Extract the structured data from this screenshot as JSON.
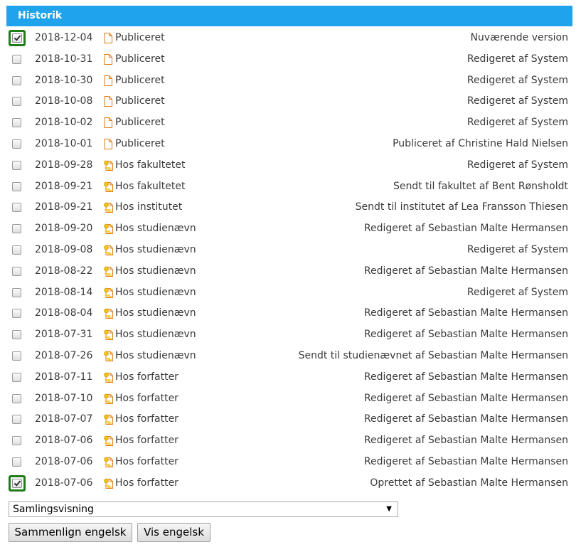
{
  "panel": {
    "title": "Historik"
  },
  "rows": [
    {
      "checked": true,
      "date": "2018-12-04",
      "status": "Publiceret",
      "status_icon": "document-icon",
      "note": "Nuværende version"
    },
    {
      "checked": false,
      "date": "2018-10-31",
      "status": "Publiceret",
      "status_icon": "document-icon",
      "note": "Redigeret af System"
    },
    {
      "checked": false,
      "date": "2018-10-30",
      "status": "Publiceret",
      "status_icon": "document-icon",
      "note": "Redigeret af System"
    },
    {
      "checked": false,
      "date": "2018-10-08",
      "status": "Publiceret",
      "status_icon": "document-icon",
      "note": "Redigeret af System"
    },
    {
      "checked": false,
      "date": "2018-10-02",
      "status": "Publiceret",
      "status_icon": "document-icon",
      "note": "Redigeret af System"
    },
    {
      "checked": false,
      "date": "2018-10-01",
      "status": "Publiceret",
      "status_icon": "document-icon",
      "note": "Publiceret af Christine Hald Nielsen"
    },
    {
      "checked": false,
      "date": "2018-09-28",
      "status": "Hos fakultetet",
      "status_icon": "document-pending-icon",
      "note": "Redigeret af System"
    },
    {
      "checked": false,
      "date": "2018-09-21",
      "status": "Hos fakultetet",
      "status_icon": "document-pending-icon",
      "note": "Sendt til fakultet af Bent Rønsholdt"
    },
    {
      "checked": false,
      "date": "2018-09-21",
      "status": "Hos institutet",
      "status_icon": "document-pending-icon",
      "note": "Sendt til institutet af Lea Fransson Thiesen"
    },
    {
      "checked": false,
      "date": "2018-09-20",
      "status": "Hos studienævn",
      "status_icon": "document-pending-icon",
      "note": "Redigeret af Sebastian Malte Hermansen"
    },
    {
      "checked": false,
      "date": "2018-09-08",
      "status": "Hos studienævn",
      "status_icon": "document-pending-icon",
      "note": "Redigeret af System"
    },
    {
      "checked": false,
      "date": "2018-08-22",
      "status": "Hos studienævn",
      "status_icon": "document-pending-icon",
      "note": "Redigeret af Sebastian Malte Hermansen"
    },
    {
      "checked": false,
      "date": "2018-08-14",
      "status": "Hos studienævn",
      "status_icon": "document-pending-icon",
      "note": "Redigeret af System"
    },
    {
      "checked": false,
      "date": "2018-08-04",
      "status": "Hos studienævn",
      "status_icon": "document-pending-icon",
      "note": "Redigeret af Sebastian Malte Hermansen"
    },
    {
      "checked": false,
      "date": "2018-07-31",
      "status": "Hos studienævn",
      "status_icon": "document-pending-icon",
      "note": "Redigeret af Sebastian Malte Hermansen"
    },
    {
      "checked": false,
      "date": "2018-07-26",
      "status": "Hos studienævn",
      "status_icon": "document-pending-icon",
      "note": "Sendt til studienævnet af Sebastian Malte Hermansen"
    },
    {
      "checked": false,
      "date": "2018-07-11",
      "status": "Hos forfatter",
      "status_icon": "document-pending-icon",
      "note": "Redigeret af Sebastian Malte Hermansen"
    },
    {
      "checked": false,
      "date": "2018-07-10",
      "status": "Hos forfatter",
      "status_icon": "document-pending-icon",
      "note": "Redigeret af Sebastian Malte Hermansen"
    },
    {
      "checked": false,
      "date": "2018-07-07",
      "status": "Hos forfatter",
      "status_icon": "document-pending-icon",
      "note": "Redigeret af Sebastian Malte Hermansen"
    },
    {
      "checked": false,
      "date": "2018-07-06",
      "status": "Hos forfatter",
      "status_icon": "document-pending-icon",
      "note": "Redigeret af Sebastian Malte Hermansen"
    },
    {
      "checked": false,
      "date": "2018-07-06",
      "status": "Hos forfatter",
      "status_icon": "document-pending-icon",
      "note": "Redigeret af Sebastian Malte Hermansen"
    },
    {
      "checked": true,
      "date": "2018-07-06",
      "status": "Hos forfatter",
      "status_icon": "document-pending-icon",
      "note": "Oprettet af Sebastian Malte Hermansen"
    }
  ],
  "controls": {
    "view_select": {
      "selected": "Samlingsvisning",
      "arrow_icon": "dropdown-arrow-icon"
    },
    "compare_button_label": "Sammenlign engelsk",
    "view_button_label": "Vis engelsk"
  },
  "colors": {
    "header_bg": "#1ea3ec",
    "header_text": "#ffffff",
    "checked_highlight": "#1e7d19",
    "icon_orange": "#e07b14",
    "icon_yellow": "#f3c21b"
  }
}
